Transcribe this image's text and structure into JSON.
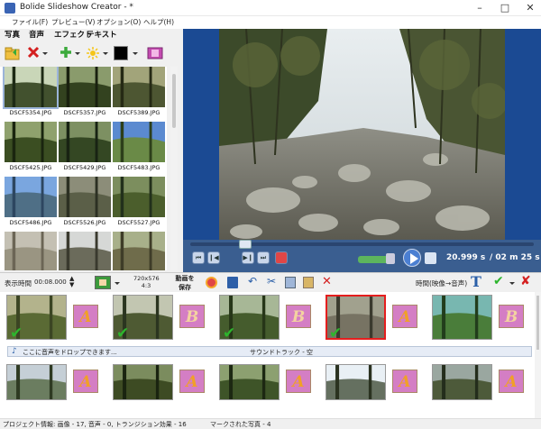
{
  "window": {
    "title": "Bolide Slideshow Creator - *",
    "minimize": "–",
    "maximize": "□",
    "close": "✕"
  },
  "menu": [
    "ファイル(F)",
    "プレビュー(V)",
    "オプション(O)",
    "ヘルプ(H)"
  ],
  "left_tabs": [
    "写真",
    "音声",
    "エフェクト",
    "テキスト"
  ],
  "thumbnails": [
    {
      "name": "DSCF5354.JPG",
      "palette": [
        "#c9d6b8",
        "#42512e",
        "#1d2a15"
      ]
    },
    {
      "name": "DSCF5357.JPG",
      "palette": [
        "#8a9b6c",
        "#33421f",
        "#19200f"
      ]
    },
    {
      "name": "DSCF5389.JPG",
      "palette": [
        "#a2a47a",
        "#4d5632",
        "#252914"
      ]
    },
    {
      "name": "DSCF5425.JPG",
      "palette": [
        "#8fa16d",
        "#3b4e22",
        "#1a250f"
      ]
    },
    {
      "name": "DSCF5429.JPG",
      "palette": [
        "#7d9062",
        "#344723",
        "#182313"
      ]
    },
    {
      "name": "DSCF5483.JPG",
      "palette": [
        "#5b8ad0",
        "#6a8a47",
        "#2c3f1a"
      ]
    },
    {
      "name": "DSCF5486.JPG",
      "palette": [
        "#7aa6df",
        "#4f6f86",
        "#2d4660"
      ]
    },
    {
      "name": "DSCF5526.JPG",
      "palette": [
        "#8c8d79",
        "#5b5f48",
        "#2c3023"
      ]
    },
    {
      "name": "DSCF5527.JPG",
      "palette": [
        "#7c8e5e",
        "#4b5e2c",
        "#22301b"
      ]
    },
    {
      "name": "",
      "palette": [
        "#c4c0b3",
        "#9a9582",
        "#6b6555"
      ]
    },
    {
      "name": "",
      "palette": [
        "#d6d8d6",
        "#6b6b5b",
        "#3a3a2e"
      ]
    },
    {
      "name": "",
      "palette": [
        "#a8b08a",
        "#6f6c4b",
        "#3e3c28"
      ]
    }
  ],
  "player": {
    "current": "20.999 s",
    "total": "/ 02 m 25 s",
    "position": 0.16,
    "volume": 0.7
  },
  "bottom_toolbar": {
    "duration_label": "表示時間",
    "duration_value": "00:08.000",
    "resolution": "720x576",
    "aspect": "4:3",
    "save_video_label1": "動画を",
    "save_video_label2": "保存",
    "time_mode": "時間(映像→音声)"
  },
  "timeline": {
    "row1": [
      {
        "type": "slide",
        "palette": [
          "#b3b38c",
          "#5a6a34",
          "#3b4523"
        ],
        "checked": true
      },
      {
        "type": "trans",
        "letter": "A"
      },
      {
        "type": "slide",
        "palette": [
          "#c2c6b1",
          "#4e5a33",
          "#2b3520"
        ],
        "checked": true
      },
      {
        "type": "trans",
        "letter": "B"
      },
      {
        "type": "slide",
        "palette": [
          "#a7b796",
          "#455c2d",
          "#263618"
        ],
        "checked": true
      },
      {
        "type": "trans",
        "letter": "B"
      },
      {
        "type": "slide",
        "palette": [
          "#a1a18e",
          "#777363",
          "#3a3a2e"
        ],
        "checked": true,
        "selected": true
      },
      {
        "type": "trans",
        "letter": "A"
      },
      {
        "type": "slide",
        "palette": [
          "#78b7b0",
          "#4a7d3a",
          "#223d1c"
        ],
        "checked": false
      },
      {
        "type": "trans",
        "letter": "B"
      }
    ],
    "row2": [
      {
        "type": "slide",
        "palette": [
          "#c5cfd6",
          "#6b7d60",
          "#2e3a22"
        ]
      },
      {
        "type": "trans",
        "letter": "A"
      },
      {
        "type": "slide",
        "palette": [
          "#7b8c5e",
          "#3d4b23",
          "#1a2410"
        ]
      },
      {
        "type": "trans",
        "letter": "A"
      },
      {
        "type": "slide",
        "palette": [
          "#8ca070",
          "#3e5428",
          "#1c2812"
        ]
      },
      {
        "type": "trans",
        "letter": "A"
      },
      {
        "type": "slide",
        "palette": [
          "#e9f0f5",
          "#657060",
          "#2a3220"
        ]
      },
      {
        "type": "trans",
        "letter": "A"
      },
      {
        "type": "slide",
        "palette": [
          "#9aa7a0",
          "#4d5a3a",
          "#242d1c"
        ]
      },
      {
        "type": "trans",
        "letter": "A"
      }
    ],
    "sound_drop": "ここに音声をドロップできます...",
    "sound_track": "サウンドトラック - 空"
  },
  "status": {
    "project": "プロジェクト情報: 画像 - 17, 音声 - 0, トランジション効果 - 16",
    "marked": "マークされた写真 - 4"
  }
}
